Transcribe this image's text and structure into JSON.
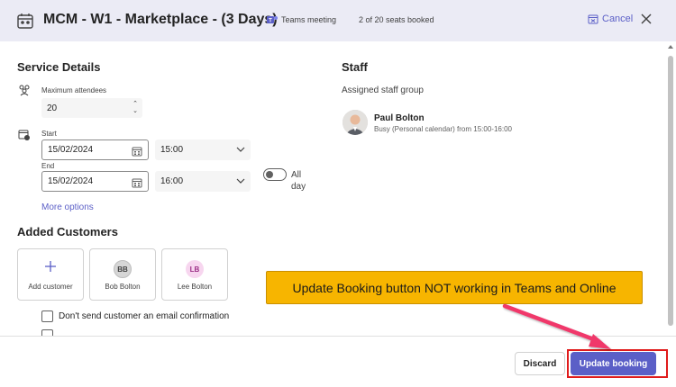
{
  "header": {
    "title": "MCM - W1 - Marketplace - (3 Days)",
    "teams_label": "Teams meeting",
    "seats": "2 of 20 seats booked",
    "cancel_label": "Cancel"
  },
  "service": {
    "section_title": "Service Details",
    "max_attendees_label": "Maximum attendees",
    "max_attendees_value": "20",
    "start_label": "Start",
    "start_date": "15/02/2024",
    "start_time": "15:00",
    "end_label": "End",
    "end_date": "15/02/2024",
    "end_time": "16:00",
    "all_day_label": "All day",
    "more_options": "More options"
  },
  "staff": {
    "section_title": "Staff",
    "group_label": "Assigned staff group",
    "member_name": "Paul Bolton",
    "member_status": "Busy (Personal calendar) from 15:00-16:00"
  },
  "customers": {
    "section_title": "Added Customers",
    "add_label": "Add customer",
    "items": [
      {
        "initials": "BB",
        "name": "Bob Bolton",
        "avatar_bg": "#d6d6d6",
        "avatar_fg": "#424242"
      },
      {
        "initials": "LB",
        "name": "Lee Bolton",
        "avatar_bg": "#f7d6ef",
        "avatar_fg": "#9b2f86"
      }
    ],
    "no_email_label": "Don't send customer an email confirmation"
  },
  "footer": {
    "discard_label": "Discard",
    "update_label": "Update booking"
  },
  "annotation": {
    "callout_text": "Update Booking button NOT working in Teams and Online"
  },
  "colors": {
    "accent": "#5b5fc7",
    "header_bg": "#ebebf5",
    "callout_bg": "#f7b500",
    "highlight_red": "#e01b1b",
    "arrow_pink": "#f0386b"
  }
}
